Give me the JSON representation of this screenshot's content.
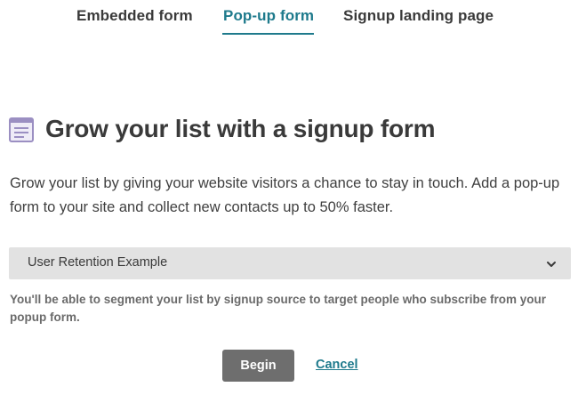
{
  "tabs": [
    {
      "label": "Embedded form"
    },
    {
      "label": "Pop-up form",
      "active": true
    },
    {
      "label": "Signup landing page"
    }
  ],
  "colors": {
    "accent": "#1e7a8c",
    "button_bg": "#6e6e6e",
    "select_bg": "#e2e2e2",
    "icon_lavender": "#9b8fc2"
  },
  "heading": {
    "icon": "form-document-icon",
    "title": "Grow your list with a signup form"
  },
  "description": "Grow your list by giving your website visitors a chance to stay in touch. Add a pop-up form to your site and collect new contacts up to 50% faster.",
  "select": {
    "value": "User Retention Example",
    "icon": "chevron-down-icon"
  },
  "helper_text": "You'll be able to segment your list by signup source to target people who subscribe from your popup form.",
  "actions": {
    "begin_label": "Begin",
    "cancel_label": "Cancel"
  }
}
